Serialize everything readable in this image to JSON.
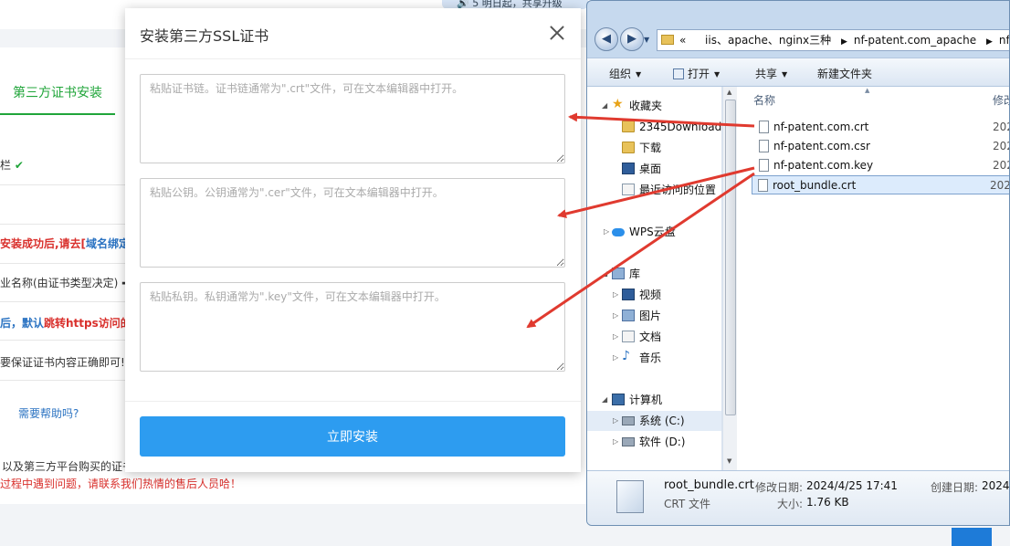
{
  "background": {
    "notice": "🔊 5  明日起，共享升级",
    "tab": "第三方证书安装",
    "rows": [
      {
        "text": "栏",
        "mark": "✔"
      },
      {
        "red": "安装成功后,请去[",
        "blue": "域名绑定",
        "red2": "]"
      },
      {
        "text": "业名称(由证书类型决定) ➡"
      },
      {
        "blue": "后，默认",
        "red": "跳转https访问的"
      },
      {
        "text": "要保证证书内容正确即可!"
      }
    ],
    "help": "需要帮助吗?",
    "bottom1": "以及第三方平台购买的证书",
    "bottom2": "过程中遇到问题，请联系我们热情的售后人员哈！"
  },
  "modal": {
    "title": "安装第三方SSL证书",
    "chain_placeholder": "粘贴证书链。证书链通常为\".crt\"文件，可在文本编辑器中打开。",
    "pubkey_placeholder": "粘贴公钥。公钥通常为\".cer\"文件，可在文本编辑器中打开。",
    "privkey_placeholder": "粘贴私钥。私钥通常为\".key\"文件，可在文本编辑器中打开。",
    "install_label": "立即安装"
  },
  "explorer": {
    "address": {
      "prefix": "«",
      "crumbs": [
        "iis、apache、nginx三种",
        "nf-patent.com_apache",
        "nf-pat"
      ]
    },
    "toolbar": {
      "organize": "组织",
      "open": "打开",
      "share": "共享",
      "new_folder": "新建文件夹"
    },
    "nav": [
      {
        "label": "收藏夹"
      },
      {
        "label": "2345Downloads"
      },
      {
        "label": "下载"
      },
      {
        "label": "桌面"
      },
      {
        "label": "最近访问的位置"
      },
      {
        "label": "WPS云盘"
      },
      {
        "label": "库"
      },
      {
        "label": "视频"
      },
      {
        "label": "图片"
      },
      {
        "label": "文档"
      },
      {
        "label": "音乐"
      },
      {
        "label": "计算机"
      },
      {
        "label": "系统 (C:)"
      },
      {
        "label": "软件 (D:)"
      }
    ],
    "columns": {
      "name": "名称",
      "modified": "修改"
    },
    "files": [
      {
        "name": "nf-patent.com.crt",
        "date": "202"
      },
      {
        "name": "nf-patent.com.csr",
        "date": "202"
      },
      {
        "name": "nf-patent.com.key",
        "date": "202"
      },
      {
        "name": "root_bundle.crt",
        "date": "202"
      }
    ],
    "details": {
      "name": "root_bundle.crt",
      "type": "CRT 文件",
      "modified_label": "修改日期:",
      "modified_value": "2024/4/25 17:41",
      "size_label": "大小:",
      "size_value": "1.76 KB",
      "created_label": "创建日期:",
      "created_value": "2024/"
    }
  },
  "colors": {
    "accent_green": "#20a53a",
    "button_blue": "#2d9cf0",
    "arrow_red": "#e03a2f"
  }
}
